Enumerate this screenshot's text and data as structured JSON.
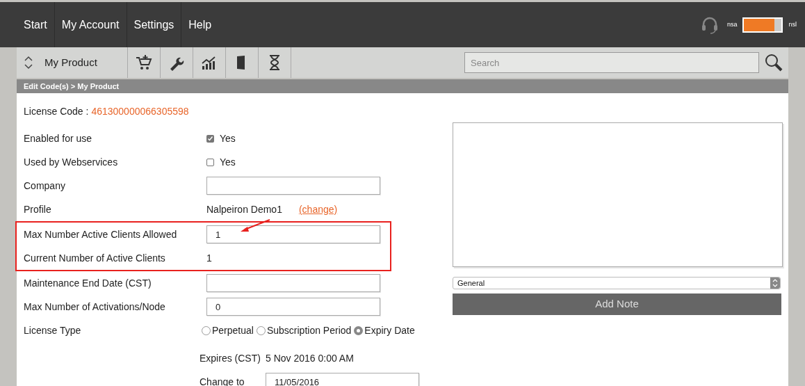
{
  "nav": {
    "items": [
      "Start",
      "My Account",
      "Settings",
      "Help"
    ],
    "toggle": {
      "left_label": "nsa",
      "right_label": "nsl",
      "on": true
    }
  },
  "toolbar": {
    "product": "My Product",
    "search": {
      "placeholder": "Search"
    }
  },
  "breadcrumb": "Edit Code(s) > My Product",
  "license_code": {
    "label": "License Code :",
    "value": "461300000066305598"
  },
  "rows": [
    {
      "kind": "checkbox",
      "label": "Enabled for use",
      "option": "Yes",
      "checked": true,
      "highlighted": false
    },
    {
      "kind": "checkbox",
      "label": "Used by Webservices",
      "option": "Yes",
      "checked": false,
      "highlighted": false
    },
    {
      "kind": "field",
      "label": "Company",
      "highlighted": false
    },
    {
      "kind": "profile",
      "label": "Profile",
      "value": "Nalpeiron Demo1",
      "link": "(change)",
      "highlighted": false
    },
    {
      "kind": "field",
      "label": "Max Number Active Clients Allowed",
      "value": "1",
      "highlighted": true
    },
    {
      "kind": "text",
      "label": "Current Number of Active Clients",
      "value": "1",
      "highlighted": true
    },
    {
      "kind": "field",
      "label": "Maintenance End Date (CST)",
      "highlighted": false
    },
    {
      "kind": "field",
      "label": "Max Number of Activations/Node",
      "value": "0",
      "highlighted": false
    },
    {
      "kind": "radio",
      "label": "License Type",
      "options": [
        {
          "label": "Perpetual",
          "selected": false
        },
        {
          "label": "Subscription Period",
          "selected": false
        },
        {
          "label": "Expiry Date",
          "selected": true
        }
      ],
      "highlighted": false
    }
  ],
  "expiry": {
    "label": "Expires (CST)",
    "value": "5 Nov 2016 0:00 AM"
  },
  "change_to": {
    "label": "Change to",
    "value": "11/05/2016"
  },
  "notes": {
    "category": "General",
    "button": "Add Note"
  }
}
